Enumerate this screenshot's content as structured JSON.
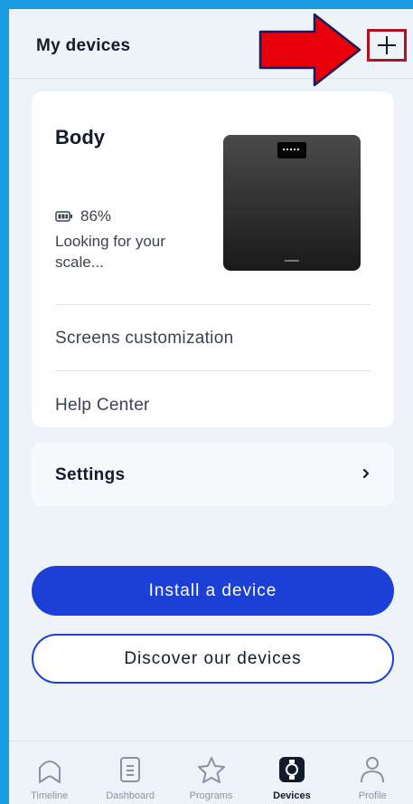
{
  "header": {
    "title": "My devices",
    "add_icon": "plus-icon"
  },
  "annotation": {
    "color": "#e8000b",
    "icon": "arrow-right-icon"
  },
  "device_card": {
    "name": "Body",
    "battery": "86%",
    "status": "Looking for your scale...",
    "menu": [
      {
        "label": "Screens customization"
      },
      {
        "label": "Help Center"
      }
    ]
  },
  "settings": {
    "label": "Settings",
    "icon": "chevron-right-icon"
  },
  "actions": {
    "install_label": "Install a device",
    "discover_label": "Discover our devices"
  },
  "tabs": [
    {
      "label": "Timeline",
      "icon": "timeline-icon",
      "active": false
    },
    {
      "label": "Dashboard",
      "icon": "dashboard-icon",
      "active": false
    },
    {
      "label": "Programs",
      "icon": "star-icon",
      "active": false
    },
    {
      "label": "Devices",
      "icon": "watch-icon",
      "active": true
    },
    {
      "label": "Profile",
      "icon": "person-icon",
      "active": false
    }
  ],
  "colors": {
    "frame": "#1a9be0",
    "background": "#eef2f9",
    "primary": "#1c3fd6",
    "text": "#121b2c"
  }
}
